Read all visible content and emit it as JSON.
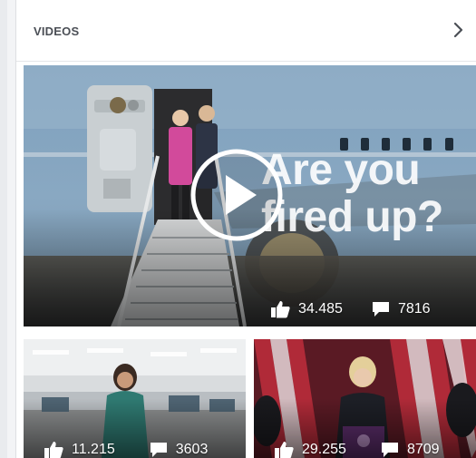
{
  "section": {
    "title": "VIDEOS",
    "next_icon": "chevron-right-icon"
  },
  "videos": [
    {
      "overlay_line1": "Are you",
      "overlay_line2": "fired up?",
      "likes": "34.485",
      "comments": "7816"
    },
    {
      "likes": "11.215",
      "comments": "3603"
    },
    {
      "likes": "29.255",
      "comments": "8709"
    }
  ],
  "icons": {
    "like": "thumbs-up-icon",
    "comment": "speech-bubble-icon",
    "play": "play-icon"
  },
  "colors": {
    "header_text": "#4b4f56",
    "card_bg": "#ffffff",
    "page_bg": "#f3f4f6",
    "overlay_text": "#ffffff"
  }
}
